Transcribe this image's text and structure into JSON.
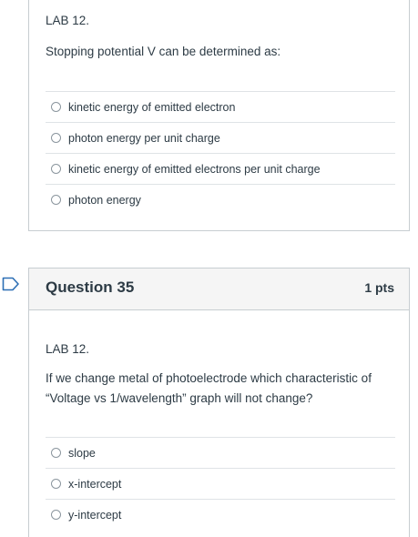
{
  "question34": {
    "lab_label": "LAB 12.",
    "prompt": "Stopping potential V can be determined as:",
    "answers": [
      "kinetic energy of emitted electron",
      "photon energy per unit charge",
      "kinetic energy of emitted electrons per unit charge",
      "photon energy"
    ]
  },
  "question35": {
    "title": "Question 35",
    "points": "1 pts",
    "lab_label": "LAB 12.",
    "prompt_line1": "If we change metal of photoelectrode which characteristic of",
    "prompt_line2": "“Voltage vs 1/wavelength” graph will not change?",
    "answers": [
      "slope",
      "x-intercept",
      "y-intercept"
    ]
  },
  "colors": {
    "flag": "#2d6fb5",
    "border": "#c7cdd1",
    "header_bg": "#f5f5f5",
    "text": "#2d3b45"
  },
  "icons": {
    "flag": "flag-icon"
  }
}
